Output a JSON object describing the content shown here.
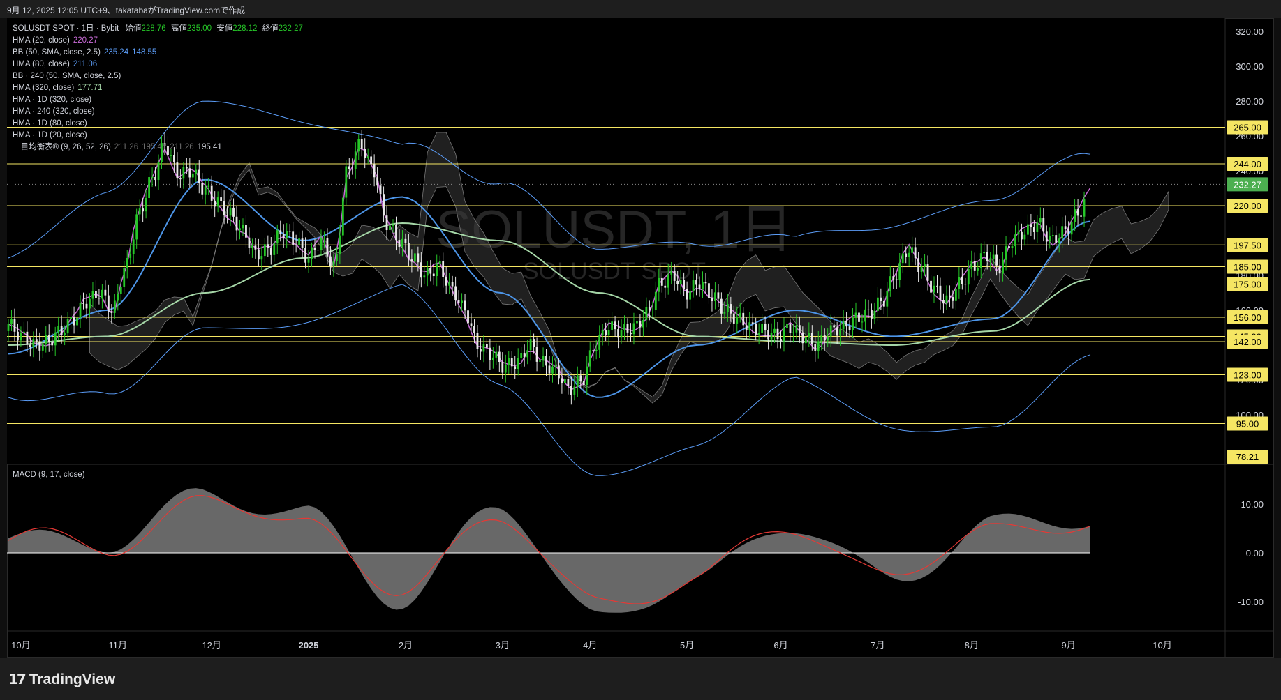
{
  "header": {
    "caption": "9月 12, 2025 12:05 UTC+9、takatabaがTradingView.comで作成"
  },
  "legend": {
    "symbol_line": {
      "symbol": "SOLUSDT SPOT · 1日 · Bybit",
      "open_label": "始値",
      "open": "228.76",
      "high_label": "高値",
      "high": "235.00",
      "low_label": "安値",
      "low": "228.12",
      "close_label": "終値",
      "close": "232.27"
    },
    "indicators": [
      {
        "name": "HMA (20, close)",
        "values": [
          "220.27"
        ],
        "colors": [
          "#c86ad6"
        ]
      },
      {
        "name": "BB (50, SMA, close, 2.5)",
        "values": [
          "235.24",
          "148.55"
        ],
        "colors": [
          "#5b9cf6",
          "#5b9cf6"
        ]
      },
      {
        "name": "HMA (80, close)",
        "values": [
          "211.06"
        ],
        "colors": [
          "#5b9cf6"
        ]
      },
      {
        "name": "BB · 240 (50, SMA, close, 2.5)",
        "values": [],
        "colors": []
      },
      {
        "name": "HMA (320, close)",
        "values": [
          "177.71"
        ],
        "colors": [
          "#a5d6a7"
        ]
      },
      {
        "name": "HMA · 1D (320, close)",
        "values": [],
        "colors": []
      },
      {
        "name": "HMA · 240 (320, close)",
        "values": [],
        "colors": []
      },
      {
        "name": "HMA · 1D (80, close)",
        "values": [],
        "colors": []
      },
      {
        "name": "HMA · 1D (20, close)",
        "values": [],
        "colors": []
      },
      {
        "name": "一目均衡表® (9, 26, 52, 26)",
        "values": [
          "211.26",
          "195.41",
          "211.26",
          "195.41"
        ],
        "colors": [
          "#6e6e6e",
          "#6e6e6e",
          "#6e6e6e",
          "#d1d4dc"
        ]
      }
    ],
    "macd_label": "MACD (9, 17, close)"
  },
  "watermark": {
    "title": "SOLUSDT, 1日",
    "subtitle": "SOLUSDT SPOT"
  },
  "price_axis": {
    "ticks": [
      "320.00",
      "300.00",
      "280.00",
      "260.00",
      "240.00",
      "220.00",
      "200.00",
      "180.00",
      "160.00",
      "140.00",
      "120.00",
      "100.00"
    ],
    "current_price": "232.27",
    "level_labels": [
      "265.00",
      "244.00",
      "220.00",
      "197.50",
      "185.00",
      "175.00",
      "156.00",
      "145.00",
      "142.00",
      "123.00",
      "95.00",
      "78.21"
    ]
  },
  "macd_axis": {
    "ticks": [
      "10.00",
      "0.00",
      "-10.00"
    ]
  },
  "time_axis": {
    "labels": [
      "10月",
      "11月",
      "12月",
      "2025",
      "2月",
      "3月",
      "4月",
      "5月",
      "6月",
      "7月",
      "8月",
      "9月",
      "10月"
    ]
  },
  "colors": {
    "level_line": "#f5e663",
    "label_bg": "#f5e663",
    "current_bg": "#4caf50",
    "bull": "#26c728",
    "bear": "#e8e8e8",
    "bb": "#5b9cf6",
    "hma20": "#c86ad6",
    "hma80": "#4d95e8",
    "hma320": "#a5d6a7",
    "macd_hist": "#7a7a7a",
    "macd_signal": "#e53935"
  },
  "footer": {
    "brand": "TradingView"
  },
  "chart_data": {
    "type": "line",
    "title": "SOLUSDT, 1日",
    "x": [
      "2024-10",
      "2024-11",
      "2024-12",
      "2025-01",
      "2025-02",
      "2025-03",
      "2025-04",
      "2025-05",
      "2025-06",
      "2025-07",
      "2025-08",
      "2025-09"
    ],
    "series": [
      {
        "name": "close",
        "values": [
          152,
          168,
          238,
          192,
          228,
          148,
          125,
          148,
          168,
          152,
          162,
          205
        ]
      },
      {
        "name": "HMA (20, close)",
        "values": [
          145,
          170,
          240,
          185,
          215,
          150,
          120,
          150,
          170,
          150,
          165,
          220.27
        ]
      },
      {
        "name": "HMA (80, close)",
        "values": [
          135,
          160,
          235,
          200,
          225,
          170,
          110,
          140,
          160,
          145,
          155,
          211.06
        ]
      },
      {
        "name": "HMA (320, close)",
        "values": [
          140,
          145,
          170,
          190,
          210,
          200,
          170,
          145,
          142,
          140,
          148,
          177.71
        ]
      },
      {
        "name": "MACD",
        "values": [
          3,
          2,
          12,
          8,
          -10,
          10,
          -14,
          -5,
          6,
          -6,
          6,
          7
        ]
      }
    ],
    "horizontal_levels": [
      265.0,
      244.0,
      220.0,
      197.5,
      185.0,
      175.0,
      156.0,
      145.0,
      142.0,
      123.0,
      95.0
    ],
    "ylim": [
      78.21,
      330
    ],
    "macd_ylim": [
      -16,
      16
    ],
    "xlabel": "",
    "ylabel": ""
  }
}
